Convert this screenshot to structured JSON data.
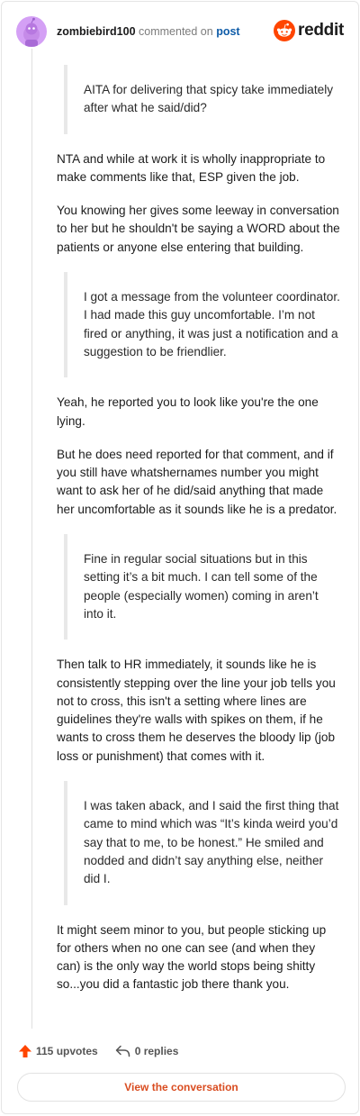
{
  "header": {
    "username": "zombiebird100",
    "action_text": "commented on",
    "post_link": "post",
    "brand_name": "reddit"
  },
  "comment": {
    "blocks": [
      {
        "type": "quote",
        "text": "AITA for delivering that spicy take immediately after what he said/did?"
      },
      {
        "type": "para",
        "text": "NTA and while at work it is wholly inappropriate to make comments like that, ESP given the job."
      },
      {
        "type": "para",
        "text": "You knowing her gives some leeway in conversation to her but he shouldn't be saying a WORD about the patients or anyone else entering that building."
      },
      {
        "type": "quote",
        "text": "I got a message from the volunteer coordinator. I had made this guy uncomfortable. I’m not fired or anything, it was just a notification and a suggestion to be friendlier."
      },
      {
        "type": "para",
        "text": "Yeah, he reported you to look like you're the one lying."
      },
      {
        "type": "para",
        "text": "But he does need reported for that comment, and if you still have whatshernames number you might want to ask her of he did/said anything that made her uncomfortable as it sounds like he is a predator."
      },
      {
        "type": "quote",
        "text": "Fine in regular social situations but in this setting it’s a bit much. I can tell some of the people (especially women) coming in aren’t into it."
      },
      {
        "type": "para",
        "text": "Then talk to HR immediately, it sounds like he is consistently stepping over the line your job tells you not to cross, this isn't a setting where lines are guidelines they're walls with spikes on them, if he wants to cross them he deserves the bloody lip (job loss or punishment) that comes with it."
      },
      {
        "type": "quote",
        "text": "I was taken aback, and I said the first thing that came to mind which was “It’s kinda weird you’d say that to me, to be honest.” He smiled and nodded and didn’t say anything else, neither did I."
      },
      {
        "type": "para",
        "text": "It might seem minor to you, but people sticking up for others when no one can see (and when they can) is the only way the world stops being shitty so...you did a fantastic job there thank you."
      }
    ]
  },
  "footer": {
    "upvotes_label": "115 upvotes",
    "replies_label": "0 replies",
    "view_button": "View the conversation"
  },
  "colors": {
    "brand": "#ff4500",
    "link": "#0f5ca8",
    "button_text": "#d94c20",
    "avatar_bg": "#d4a0f5"
  },
  "icons": {
    "avatar": "snoo-avatar-icon",
    "brand": "reddit-logo-icon",
    "upvote": "upvote-arrow-icon",
    "reply": "reply-arrow-icon"
  }
}
